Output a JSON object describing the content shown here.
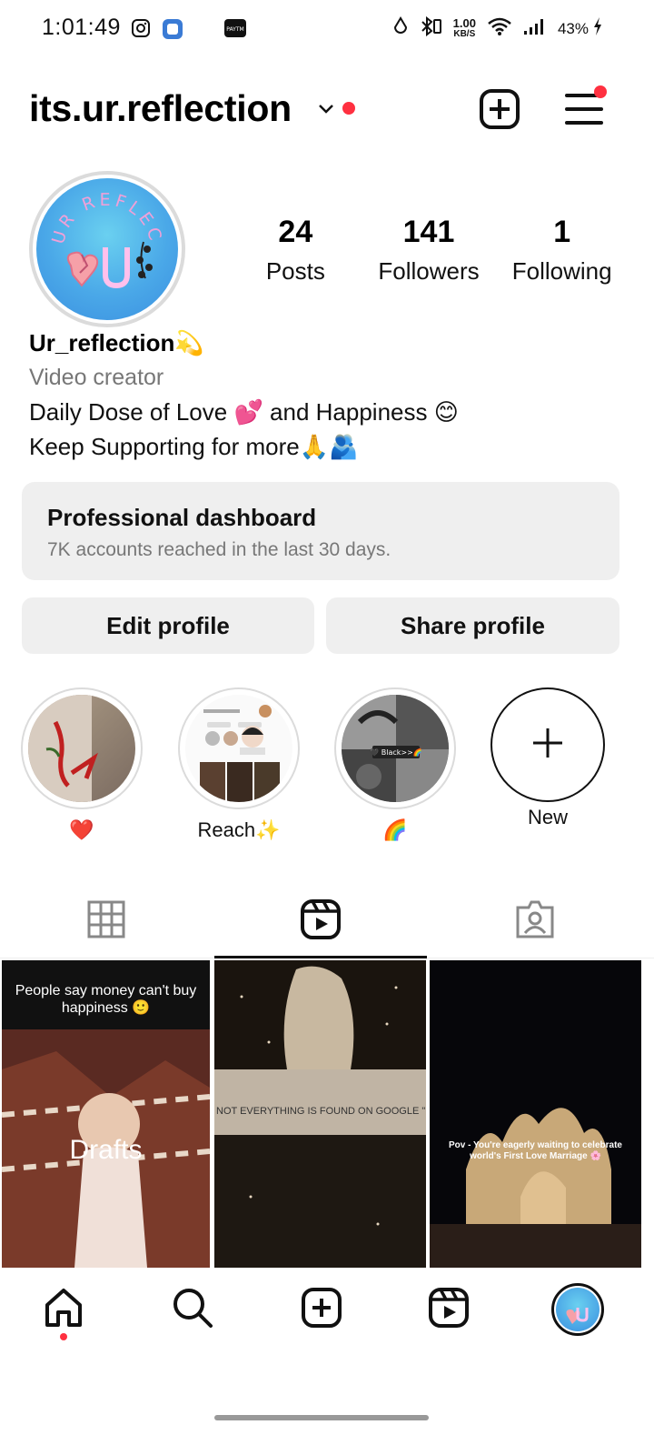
{
  "status_bar": {
    "time": "1:01:49",
    "speed_value": "1.00",
    "speed_unit": "KB/S",
    "battery": "43%",
    "paytm_label": "PAYTM"
  },
  "header": {
    "username": "its.ur.reflection",
    "accent_color": "#ff3040"
  },
  "avatar": {
    "text": "UR REFLECTION",
    "letter": "U"
  },
  "stats": [
    {
      "value": "24",
      "label": "Posts"
    },
    {
      "value": "141",
      "label": "Followers"
    },
    {
      "value": "1",
      "label": "Following"
    }
  ],
  "bio": {
    "name": "Ur_reflection💫",
    "category": "Video creator",
    "line1": "Daily Dose of Love 💕 and Happiness 😊",
    "line2": "Keep Supporting for more🙏🫂"
  },
  "dashboard": {
    "title": "Professional dashboard",
    "subtitle": "7K accounts reached in the last 30 days."
  },
  "buttons": {
    "edit": "Edit profile",
    "share": "Share profile"
  },
  "highlights": [
    {
      "label": "❤️"
    },
    {
      "label": "Reach✨"
    },
    {
      "label": "🌈"
    },
    {
      "label": "New"
    }
  ],
  "highlight_inner": {
    "black_label": "🖤 Black>>🌈",
    "following": "Following ⌄",
    "message": "Message"
  },
  "grid": {
    "cell1_caption": "People say money can't buy happiness 🙂",
    "cell1_overlay": "Drafts",
    "cell2_caption": "NOT EVERYTHING IS FOUND ON GOOGLE \"",
    "cell3_caption": "Pov - You're eagerly waiting to celebrate world's First Love Marriage 🌸"
  }
}
